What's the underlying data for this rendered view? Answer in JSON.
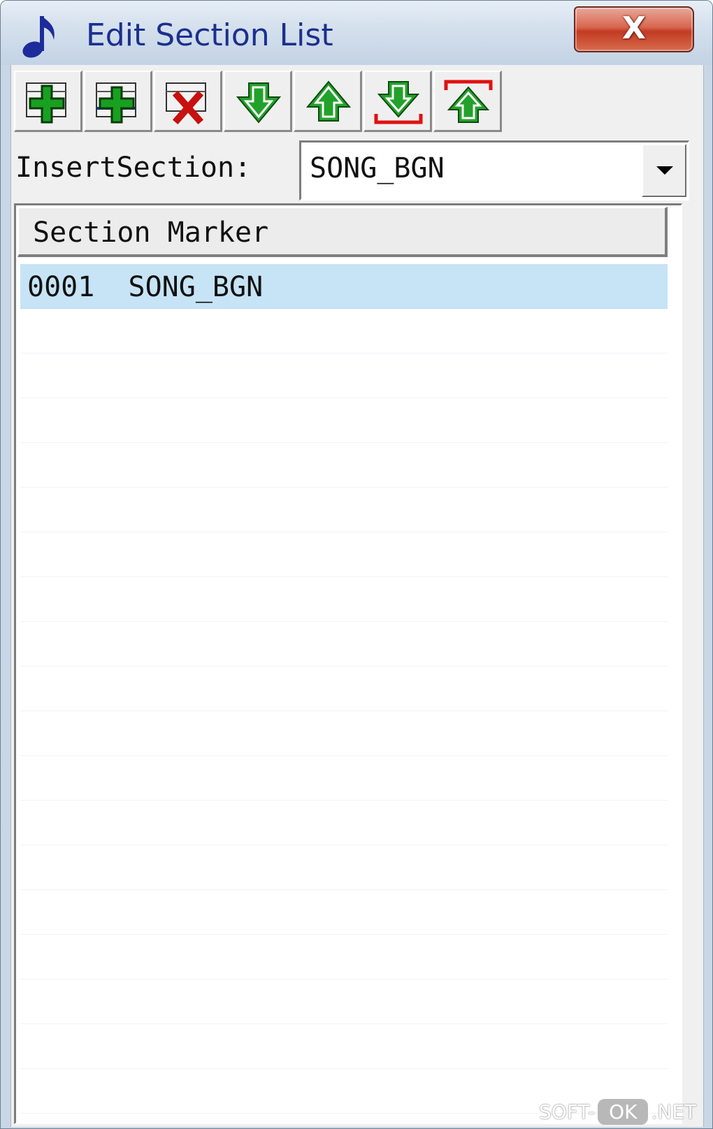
{
  "window": {
    "title": "Edit Section List",
    "close_label": "X"
  },
  "toolbar": {
    "buttons": [
      {
        "icon": "add-icon"
      },
      {
        "icon": "insert-icon"
      },
      {
        "icon": "delete-icon"
      },
      {
        "icon": "move-down-icon"
      },
      {
        "icon": "move-up-icon"
      },
      {
        "icon": "move-to-bottom-icon"
      },
      {
        "icon": "move-to-top-icon"
      }
    ]
  },
  "insert_section": {
    "label": "InsertSection:",
    "value": "SONG_BGN"
  },
  "list": {
    "header": "Section Marker",
    "rows": [
      {
        "text": "0001  SONG_BGN",
        "selected": true
      }
    ]
  },
  "watermark": {
    "left": "SOFT-",
    "middle": "OK",
    "right": ".NET"
  },
  "colors": {
    "title_text": "#1b2f8f",
    "selected_row": "#c6e4f6",
    "icon_green": "#18a020",
    "icon_red": "#d01010"
  }
}
